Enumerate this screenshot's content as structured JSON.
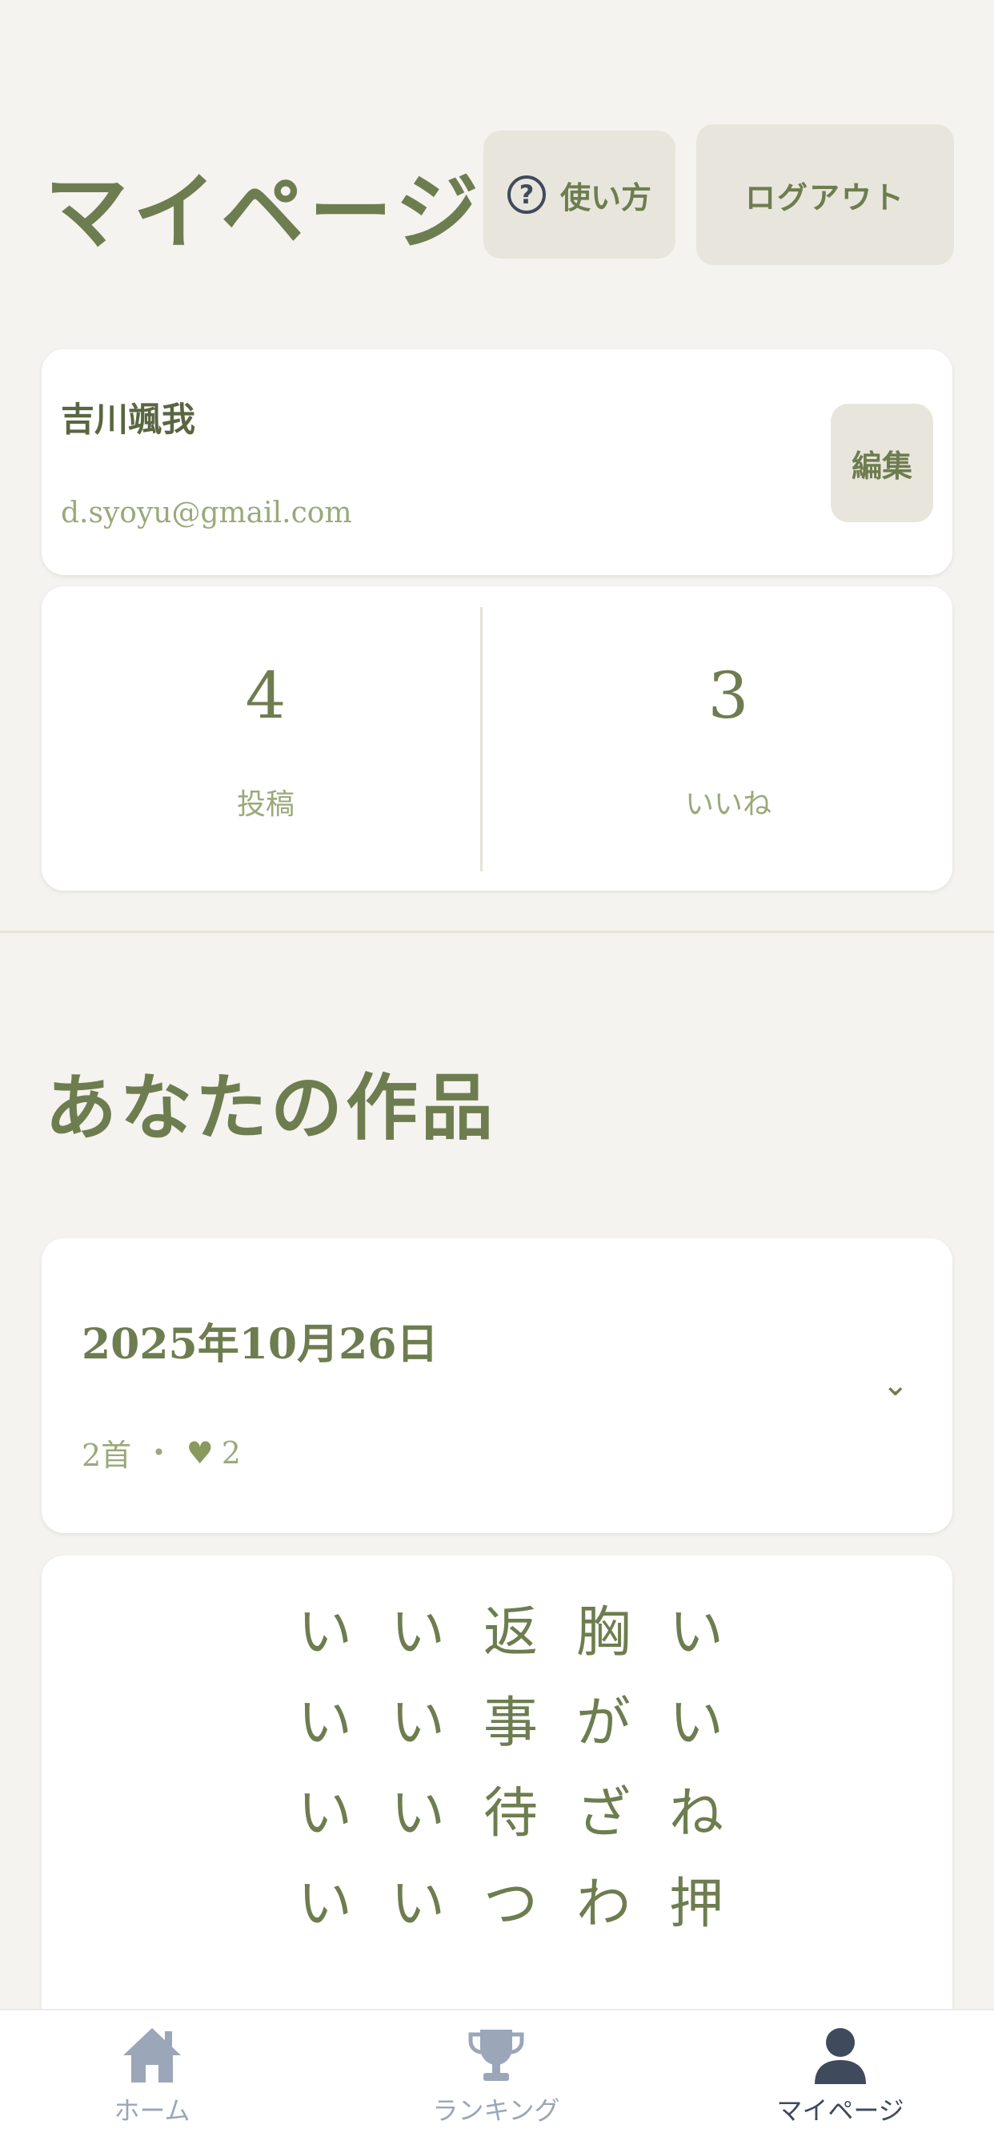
{
  "header": {
    "title": "マイページ",
    "help_label": "使い方",
    "logout_label": "ログアウト"
  },
  "profile": {
    "name": "吉川颯我",
    "email": "d.syoyu@gmail.com",
    "edit_label": "編集"
  },
  "stats": {
    "posts_value": "4",
    "posts_label": "投稿",
    "likes_value": "3",
    "likes_label": "いいね"
  },
  "works": {
    "section_title": "あなたの作品",
    "groups": [
      {
        "date": "2025年10月26日",
        "count": "2首",
        "likes": "2"
      }
    ]
  },
  "poem": {
    "columns": [
      [
        "い",
        "い",
        "ね",
        "押"
      ],
      [
        "胸",
        "が",
        "ざ",
        "わ"
      ],
      [
        "返",
        "事",
        "待",
        "つ"
      ],
      [
        "い",
        "い",
        "い",
        "い"
      ],
      [
        "い",
        "い",
        "い",
        "い"
      ]
    ]
  },
  "tabbar": {
    "home_label": "ホーム",
    "ranking_label": "ランキング",
    "mypage_label": "マイページ"
  },
  "colors": {
    "background": "#f4f3ef",
    "accent": "#6e7d4f",
    "muted": "#9aa97a",
    "button_bg": "#e8e6dc",
    "tab_active": "#3f4a5c",
    "tab_inactive": "#9ba6b8"
  }
}
